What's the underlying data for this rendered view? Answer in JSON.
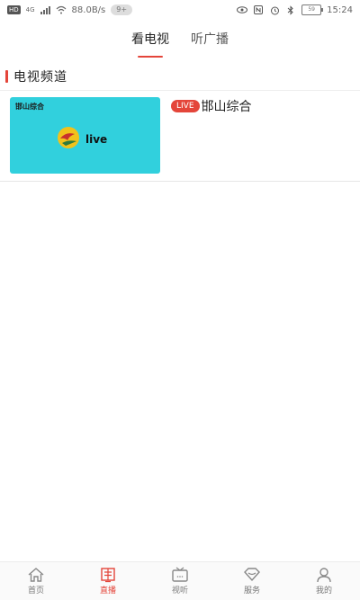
{
  "status_bar": {
    "left_badge": "HD",
    "network": "4G",
    "speed": "88.0B/s",
    "pill": "9+",
    "time": "15:24",
    "battery_text": "59"
  },
  "top_tabs": [
    {
      "label": "看电视",
      "active": true
    },
    {
      "label": "听广播",
      "active": false
    }
  ],
  "section": {
    "title": "电视频道"
  },
  "channels": [
    {
      "thumb_label": "邯山综合",
      "thumb_live_text": "live",
      "badge": "LIVE",
      "name": "邯山综合"
    }
  ],
  "bottom_nav": [
    {
      "label": "首页",
      "icon": "home-icon",
      "active": false
    },
    {
      "label": "直播",
      "icon": "live-icon",
      "active": true
    },
    {
      "label": "视听",
      "icon": "tv-icon",
      "active": false
    },
    {
      "label": "服务",
      "icon": "service-icon",
      "active": false
    },
    {
      "label": "我的",
      "icon": "user-icon",
      "active": false
    }
  ],
  "colors": {
    "accent": "#e4453a",
    "thumb_bg": "#31d0dd"
  }
}
